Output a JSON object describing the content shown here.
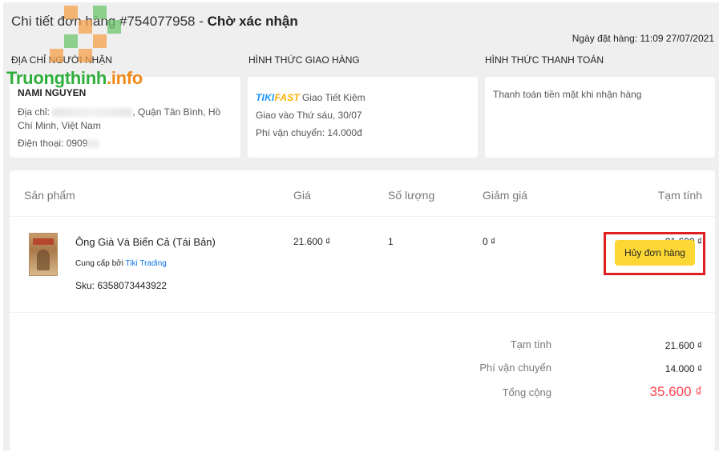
{
  "header": {
    "title_prefix": "Chi tiết đơn hàng #754077958 - ",
    "status": "Chờ xác nhận",
    "order_date": "Ngày đặt hàng: 11:09 27/07/2021"
  },
  "sections": {
    "recipient_label": "ĐỊA CHỈ NGƯỜI NHẬN",
    "shipping_label": "HÌNH THỨC GIAO HÀNG",
    "payment_label": "HÌNH THỨC THANH TOÁN"
  },
  "recipient": {
    "name": "NAMI NGUYEN",
    "address_prefix": "Địa chỉ:",
    "address_suffix": ", Quận Tân Bình, Hồ",
    "address_line2": "Chí Minh, Việt Nam",
    "phone_prefix": "Điện thoại: 0909"
  },
  "shipping": {
    "logo_tiki": "TIKI",
    "logo_fast": "FAST",
    "method": "Giao Tiết Kiệm",
    "delivery": "Giao vào Thứ sáu, 30/07",
    "fee": "Phí vận chuyển: 14.000đ"
  },
  "payment": {
    "method": "Thanh toán tiền mặt khi nhận hàng"
  },
  "table": {
    "headers": [
      "Sản phẩm",
      "Giá",
      "Số lượng",
      "Giảm giá",
      "Tạm tính"
    ],
    "product": {
      "name": "Ông Già Và Biển Cả (Tái Bản)",
      "supplier_prefix": "Cung cấp bởi",
      "supplier": "Tiki Trading",
      "sku": "Sku: 6358073443922",
      "price": "21.600 ₫",
      "quantity": "1",
      "discount": "0 ₫",
      "subtotal": "21.600 ₫"
    }
  },
  "summary": {
    "subtotal_label": "Tạm tính",
    "subtotal_value": "21.600 ₫",
    "shipping_label": "Phí vận chuyển",
    "shipping_value": "14.000 ₫",
    "total_label": "Tổng cộng",
    "total_value": "35.600 ₫"
  },
  "actions": {
    "cancel_label": "Hủy đơn hàng"
  },
  "watermark": {
    "brand": "Truongthinh",
    "suffix": ".info"
  },
  "colors": {
    "accent_yellow": "#fdd835",
    "total_red": "#ff424e",
    "link_blue": "#0b74e5",
    "highlight_red": "#e02020"
  }
}
